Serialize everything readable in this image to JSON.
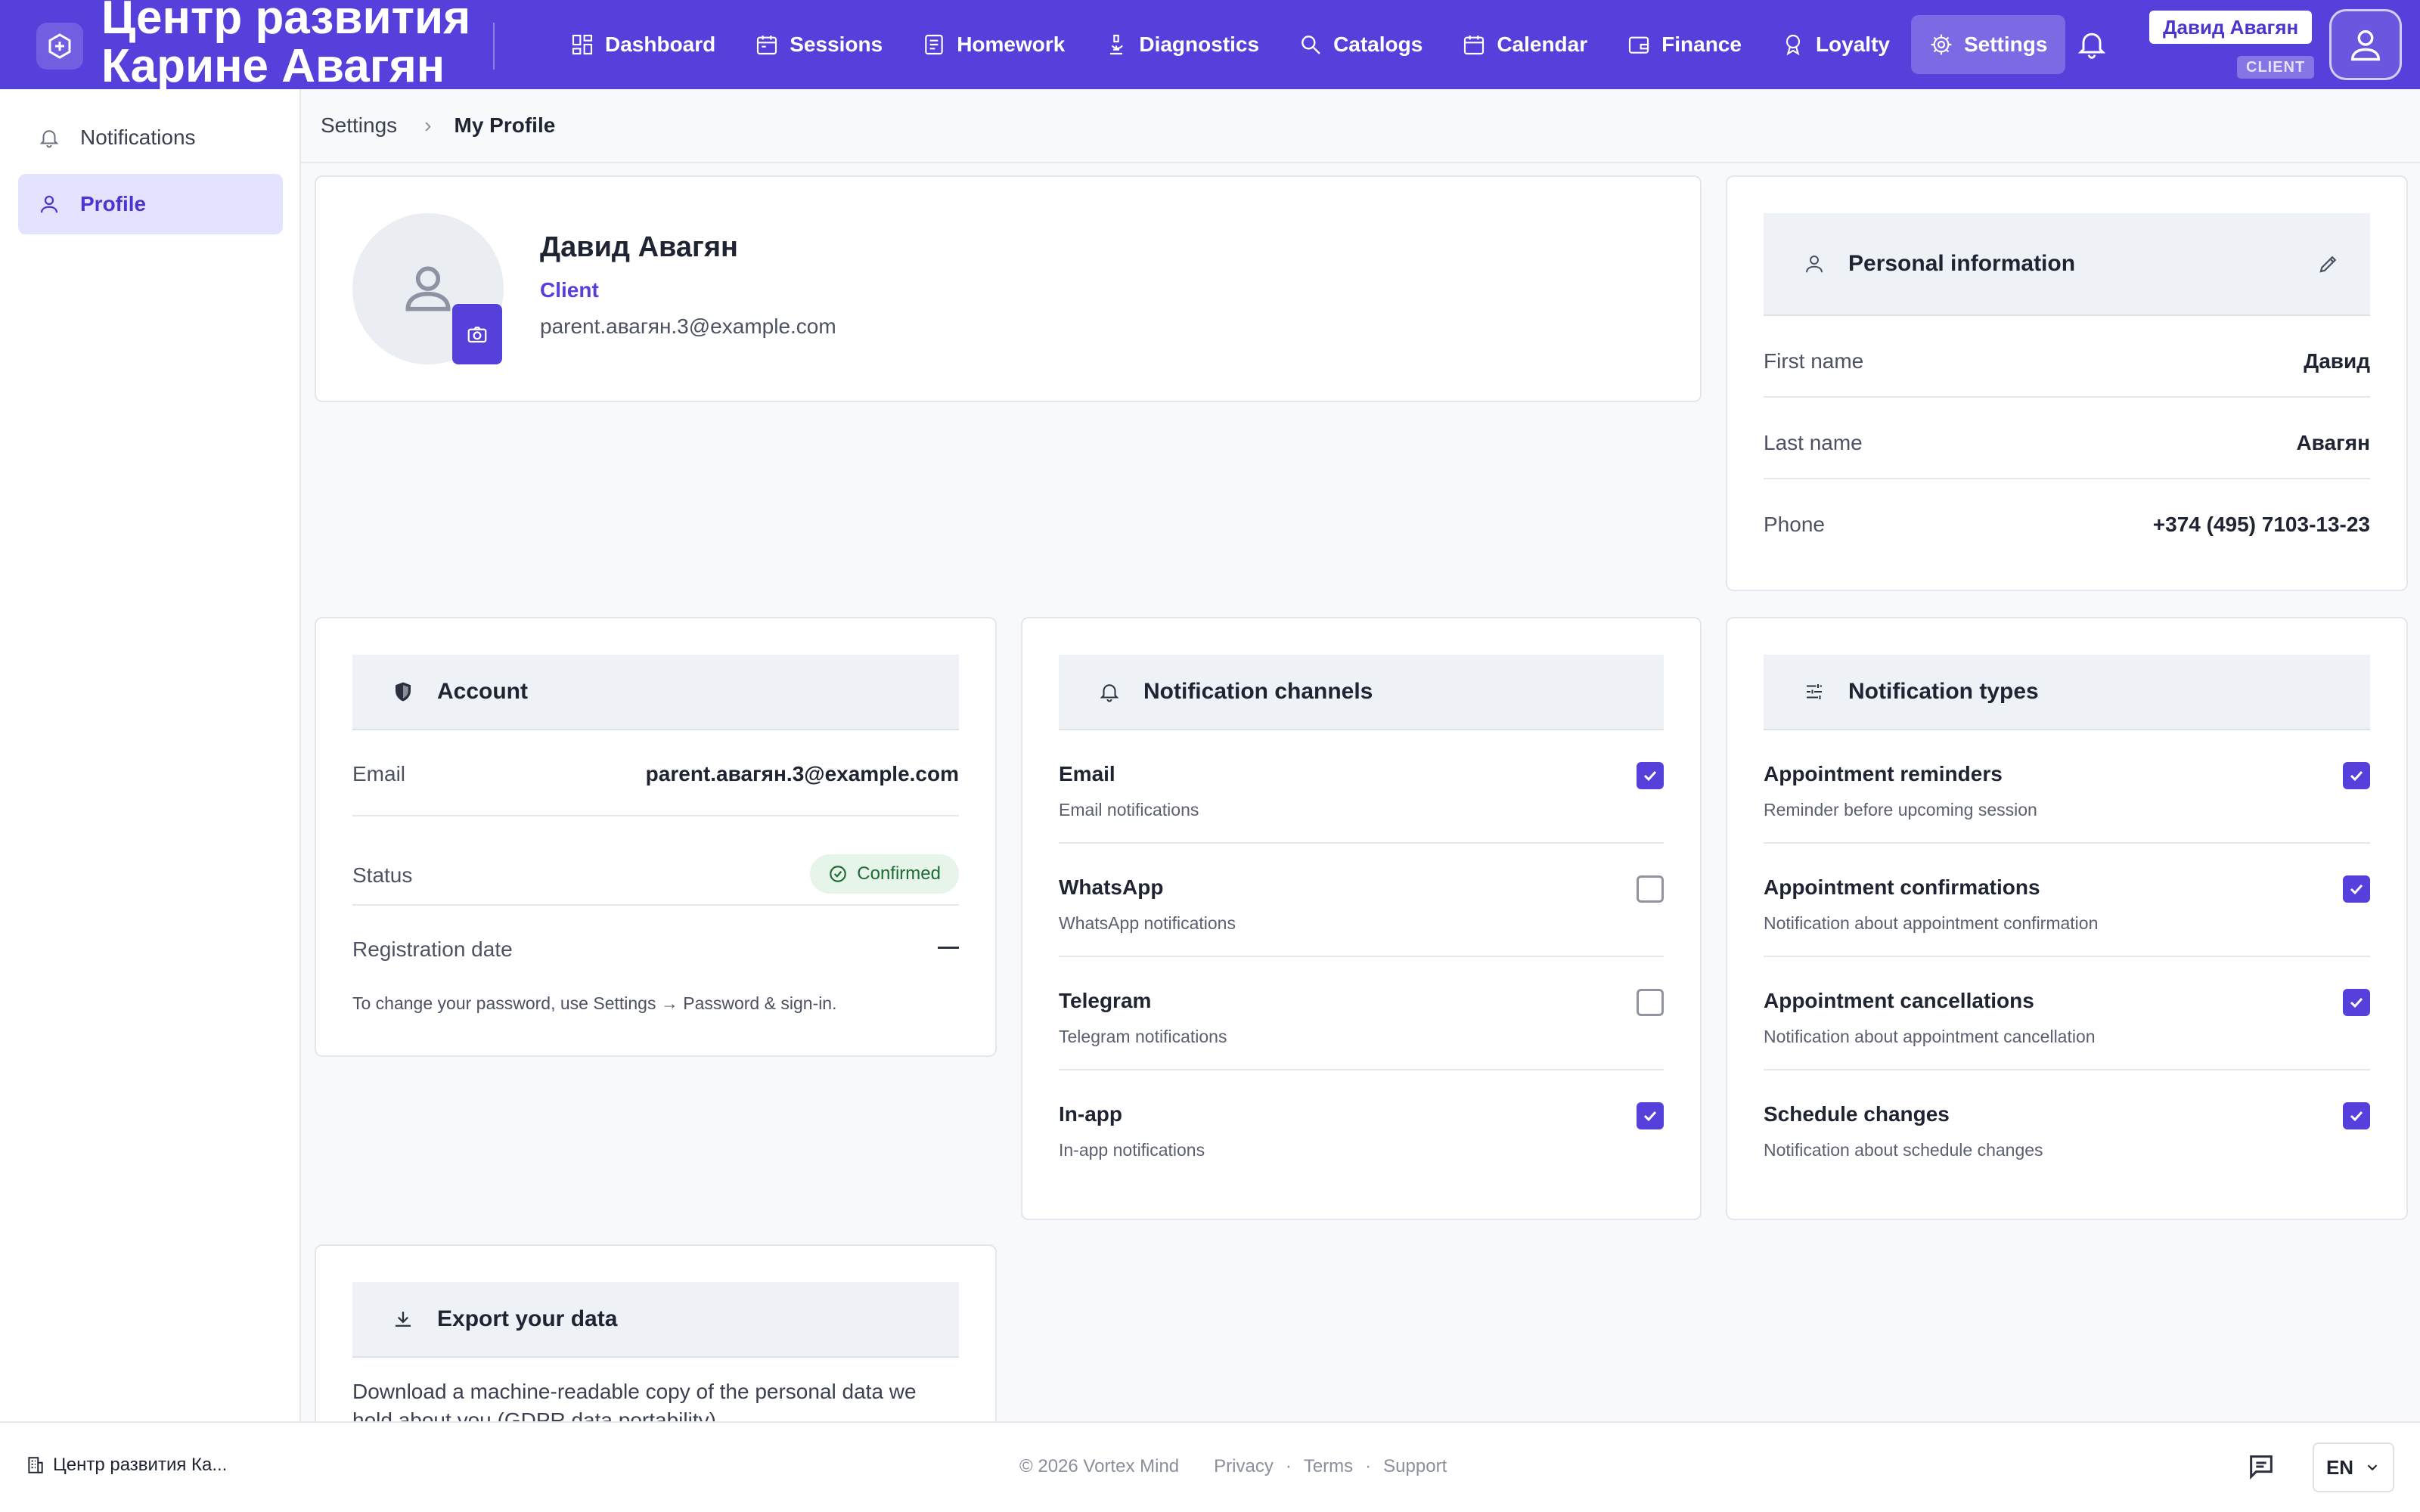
{
  "app": {
    "org_title": "Центр развития Карине Авагян",
    "user_name": "Давид Авагян",
    "user_role": "CLIENT"
  },
  "nav": [
    {
      "label": "Dashboard",
      "icon": "dashboard-icon"
    },
    {
      "label": "Sessions",
      "icon": "calendar-icon"
    },
    {
      "label": "Homework",
      "icon": "document-icon"
    },
    {
      "label": "Diagnostics",
      "icon": "microscope-icon"
    },
    {
      "label": "Catalogs",
      "icon": "search-icon"
    },
    {
      "label": "Calendar",
      "icon": "calendar-icon"
    },
    {
      "label": "Finance",
      "icon": "wallet-icon"
    },
    {
      "label": "Loyalty",
      "icon": "award-icon"
    },
    {
      "label": "Settings",
      "icon": "gear-icon",
      "active": true
    }
  ],
  "sidebar": {
    "items": [
      {
        "label": "Notifications",
        "icon": "bell-icon"
      },
      {
        "label": "Profile",
        "icon": "user-icon",
        "active": true
      }
    ]
  },
  "breadcrumb": {
    "parent": "Settings",
    "separator": "›",
    "current": "My Profile"
  },
  "profile": {
    "name": "Давид Авагян",
    "role": "Client",
    "email": "parent.авагян.3@example.com"
  },
  "personal_info": {
    "title": "Personal information",
    "rows": [
      {
        "label": "First name",
        "value": "Давид"
      },
      {
        "label": "Last name",
        "value": "Авагян"
      },
      {
        "label": "Phone",
        "value": "+374 (495) 7103-13-23"
      }
    ]
  },
  "account": {
    "title": "Account",
    "email_label": "Email",
    "email_value": "parent.авагян.3@example.com",
    "status_label": "Status",
    "status_value": "Confirmed",
    "reg_label": "Registration date",
    "reg_value": "—",
    "password_note": "To change your password, use Settings → Password & sign-in."
  },
  "channels": {
    "title": "Notification channels",
    "items": [
      {
        "title": "Email",
        "subtitle": "Email notifications",
        "checked": true
      },
      {
        "title": "WhatsApp",
        "subtitle": "WhatsApp notifications",
        "checked": false
      },
      {
        "title": "Telegram",
        "subtitle": "Telegram notifications",
        "checked": false
      },
      {
        "title": "In-app",
        "subtitle": "In-app notifications",
        "checked": true
      }
    ]
  },
  "types": {
    "title": "Notification types",
    "items": [
      {
        "title": "Appointment reminders",
        "subtitle": "Reminder before upcoming session",
        "checked": true
      },
      {
        "title": "Appointment confirmations",
        "subtitle": "Notification about appointment confirmation",
        "checked": true
      },
      {
        "title": "Appointment cancellations",
        "subtitle": "Notification about appointment cancellation",
        "checked": true
      },
      {
        "title": "Schedule changes",
        "subtitle": "Notification about schedule changes",
        "checked": true
      }
    ]
  },
  "export": {
    "title": "Export your data",
    "description": "Download a machine-readable copy of the personal data we hold about you (GDPR data portability)."
  },
  "footer": {
    "org_short": "Центр развития Ка...",
    "copyright": "© 2026 Vortex Mind",
    "links": [
      "Privacy",
      "Terms",
      "Support"
    ],
    "language": "EN"
  },
  "colors": {
    "brand": "#5640dc",
    "active_bg": "#e4e3ff",
    "success": "#1e6b34"
  }
}
